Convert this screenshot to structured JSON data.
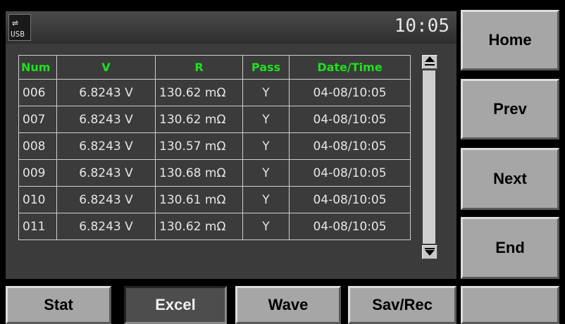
{
  "status_bar": {
    "usb_label": "USB",
    "time": "10:05"
  },
  "table": {
    "headers": [
      "Num",
      "V",
      "R",
      "Pass",
      "Date/Time"
    ],
    "rows": [
      [
        "006",
        "6.8243 V",
        "130.62 mΩ",
        "Y",
        "04-08/10:05"
      ],
      [
        "007",
        "6.8243 V",
        "130.62 mΩ",
        "Y",
        "04-08/10:05"
      ],
      [
        "008",
        "6.8243 V",
        "130.57 mΩ",
        "Y",
        "04-08/10:05"
      ],
      [
        "009",
        "6.8243 V",
        "130.68 mΩ",
        "Y",
        "04-08/10:05"
      ],
      [
        "010",
        "6.8243 V",
        "130.61 mΩ",
        "Y",
        "04-08/10:05"
      ],
      [
        "011",
        "6.8243 V",
        "130.62 mΩ",
        "Y",
        "04-08/10:05"
      ]
    ]
  },
  "side_buttons": {
    "home": "Home",
    "prev": "Prev",
    "next": "Next",
    "end": "End"
  },
  "bottom_buttons": {
    "stat": "Stat",
    "excel": "Excel",
    "wave": "Wave",
    "savrec": "Sav/Rec",
    "blank": ""
  },
  "colors": {
    "header_text": "#1ee11e",
    "cell_text": "#e6e6e6",
    "panel_bg": "#3b3b3b",
    "button_bg": "#a6a6a6",
    "active_button_bg": "#4d4d4d"
  },
  "icons": [
    "usb-icon",
    "scroll-up-arrow-icon",
    "scroll-down-arrow-icon"
  ]
}
